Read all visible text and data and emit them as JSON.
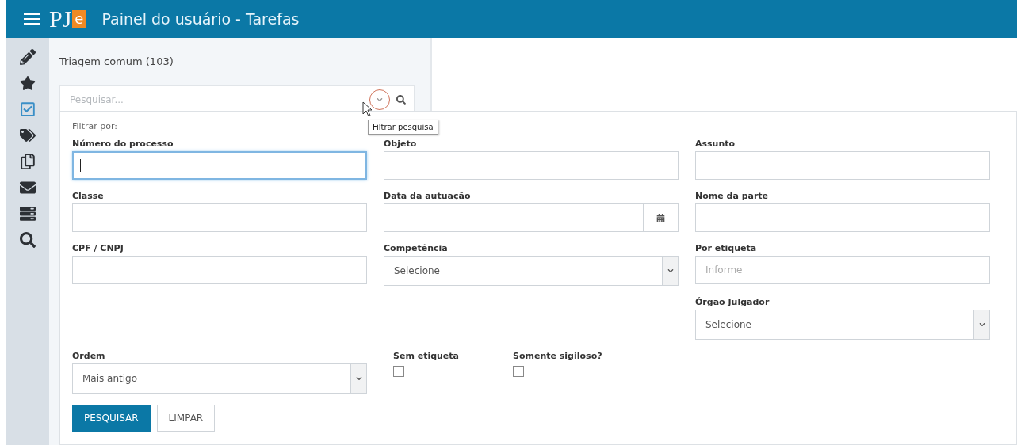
{
  "header": {
    "logo": {
      "text": "PJ",
      "accent": "e"
    },
    "title": "Painel do usuário - Tarefas"
  },
  "sidebar": {
    "items": [
      {
        "selected": false
      },
      {
        "selected": false
      },
      {
        "selected": true
      },
      {
        "selected": false
      },
      {
        "selected": false
      },
      {
        "selected": false
      },
      {
        "selected": false
      },
      {
        "selected": false
      }
    ]
  },
  "panel": {
    "title": "Triagem comum (103)",
    "search": {
      "placeholder": "Pesquisar..."
    }
  },
  "tooltip": "Filtrar pesquisa",
  "filter": {
    "heading": "Filtrar por:",
    "fields": [
      {
        "kind": "text",
        "label": "Número do processo",
        "focused": true
      },
      {
        "kind": "text",
        "label": "Objeto",
        "focused": false
      },
      {
        "kind": "text",
        "label": "Assunto",
        "focused": false
      },
      {
        "kind": "text",
        "label": "Classe",
        "focused": false
      },
      {
        "kind": "date",
        "label": "Data da autuação"
      },
      {
        "kind": "text",
        "label": "Nome da parte",
        "focused": false
      },
      {
        "kind": "text",
        "label": "CPF / CNPJ",
        "focused": false
      },
      {
        "kind": "select",
        "label": "Competência",
        "value": "Selecione"
      },
      {
        "kind": "text",
        "label": "Por etiqueta",
        "placeholder": "Informe",
        "focused": false
      },
      {
        "kind": "select",
        "label": "Órgão Julgador",
        "value": "Selecione"
      },
      {
        "kind": "select",
        "label": "Ordem",
        "value": "Mais antigo"
      },
      {
        "kind": "checkbox",
        "label": "Sem etiqueta",
        "checked": false
      },
      {
        "kind": "checkbox",
        "label": "Somente sigiloso?",
        "checked": false
      }
    ],
    "buttons": [
      {
        "kind": "primary",
        "label": "PESQUISAR"
      },
      {
        "kind": "secondary",
        "label": "LIMPAR"
      }
    ]
  }
}
